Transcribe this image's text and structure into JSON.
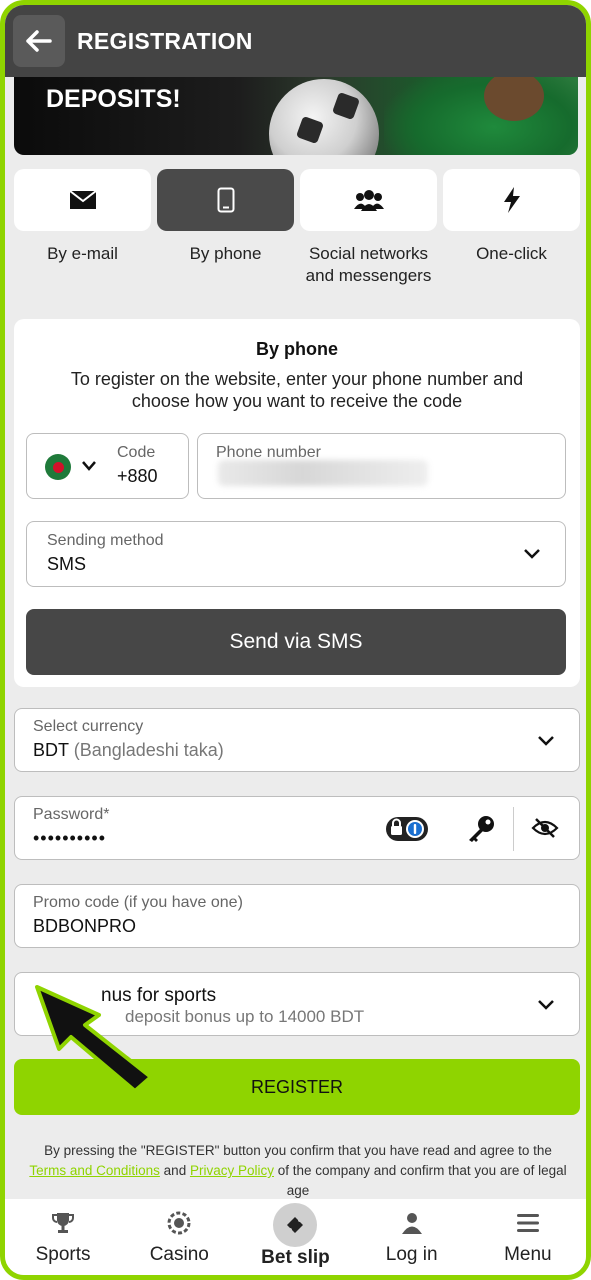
{
  "header": {
    "title": "REGISTRATION"
  },
  "banner": {
    "text": "DEPOSITS!"
  },
  "tabs": [
    {
      "label": "By e-mail",
      "icon": "envelope-icon"
    },
    {
      "label": "By phone",
      "icon": "phone-icon"
    },
    {
      "label": "Social networks and messengers",
      "icon": "users-icon"
    },
    {
      "label": "One-click",
      "icon": "lightning-icon"
    }
  ],
  "phone_card": {
    "title": "By phone",
    "description": "To register on the website, enter your phone number and choose how you want to receive the code",
    "code_label": "Code",
    "code_value": "+880",
    "phone_label": "Phone number",
    "sending_label": "Sending method",
    "sending_value": "SMS",
    "send_button": "Send via SMS"
  },
  "currency": {
    "label": "Select currency",
    "code": "BDT",
    "name": "(Bangladeshi taka)"
  },
  "password": {
    "label": "Password*",
    "value": "••••••••••"
  },
  "promo": {
    "label": "Promo code (if you have one)",
    "value": "BDBONPRO"
  },
  "bonus": {
    "title": "nus for sports",
    "subtitle": "deposit bonus up to 14000 BDT"
  },
  "register_button": "REGISTER",
  "legal": {
    "before": "By pressing the \"REGISTER\" button you confirm that you have read and agree to the ",
    "terms": "Terms and Conditions",
    "and": " and ",
    "privacy": "Privacy Policy",
    "after": " of the company and confirm that you are of legal age"
  },
  "nav": [
    {
      "label": "Sports",
      "icon": "trophy-icon"
    },
    {
      "label": "Casino",
      "icon": "chip-icon"
    },
    {
      "label": "Bet slip",
      "icon": "ticket-icon"
    },
    {
      "label": "Log in",
      "icon": "user-icon"
    },
    {
      "label": "Menu",
      "icon": "menu-icon"
    }
  ],
  "colors": {
    "accent": "#8fd400",
    "dark": "#474747",
    "bg": "#ececec"
  }
}
